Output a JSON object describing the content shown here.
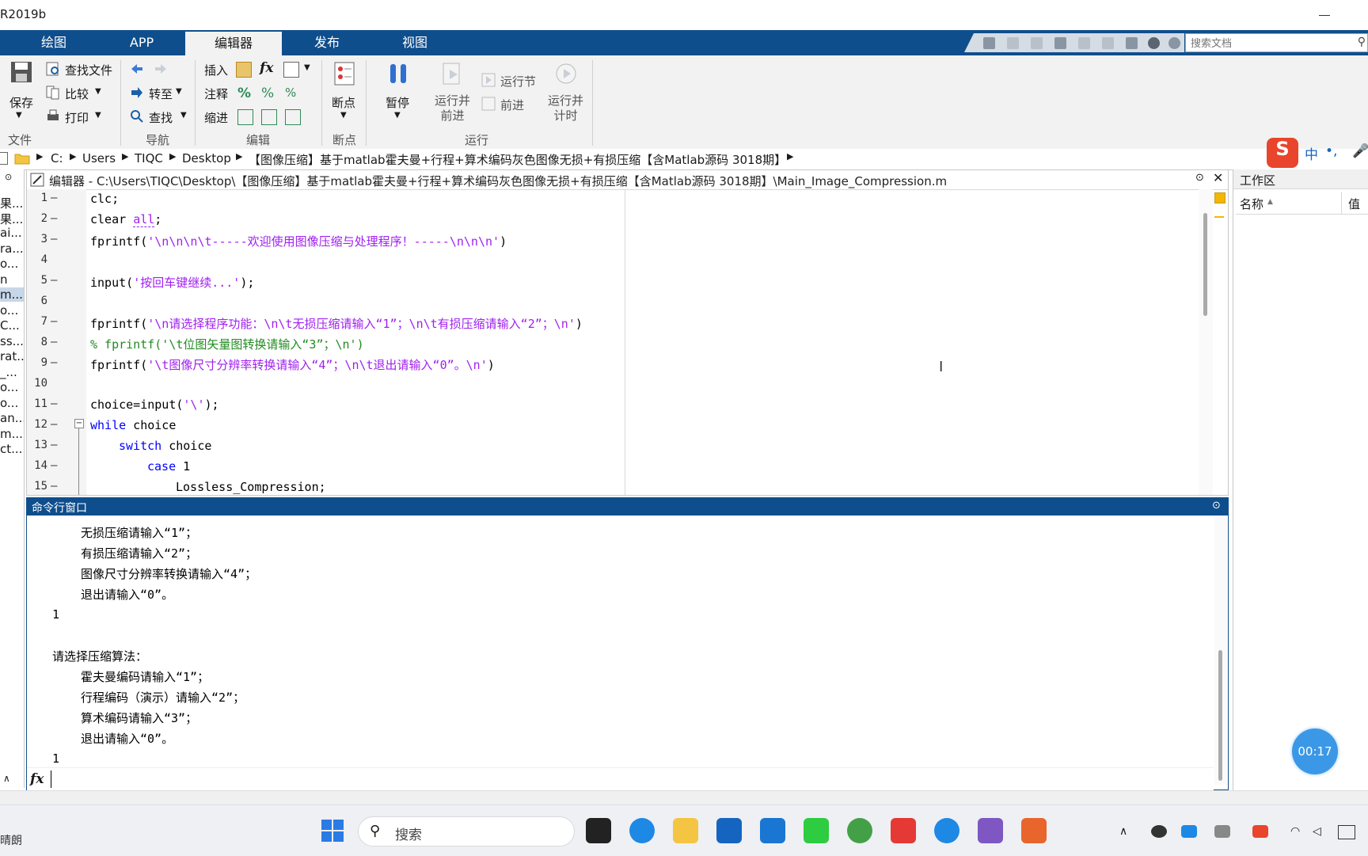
{
  "window": {
    "title": "R2019b"
  },
  "tabs": [
    {
      "label": "绘图",
      "active": false
    },
    {
      "label": "APP",
      "active": false
    },
    {
      "label": "编辑器",
      "active": true
    },
    {
      "label": "发布",
      "active": false
    },
    {
      "label": "视图",
      "active": false
    }
  ],
  "search_docs": {
    "placeholder": "搜索文档"
  },
  "ribbon": {
    "file": {
      "save": "保存",
      "find_files": "查找文件",
      "compare": "比较",
      "print": "打印",
      "group": "文件"
    },
    "nav": {
      "goto": "转至",
      "find": "查找",
      "group": "导航"
    },
    "edit": {
      "insert": "插入",
      "comment": "注释",
      "indent": "缩进",
      "group": "编辑"
    },
    "breakpoints": {
      "label": "断点",
      "group": "断点"
    },
    "run": {
      "pause": "暂停",
      "run_advance": "运行并\n前进",
      "run_section": "运行节",
      "advance": "前进",
      "run_time": "运行并\n计时",
      "group": "运行"
    }
  },
  "address": {
    "crumbs": [
      "C:",
      "Users",
      "TIQC",
      "Desktop",
      "【图像压缩】基于matlab霍夫曼+行程+算术编码灰色图像无损+有损压缩【含Matlab源码 3018期】"
    ]
  },
  "left_panel": {
    "files": [
      "果...",
      "果...",
      "ai...",
      "ra...",
      "o...",
      "n",
      "m...",
      "o...",
      "C...",
      "ss...",
      "rat...",
      "_...",
      "o...",
      "o...",
      "an...",
      "m...",
      "ct..."
    ]
  },
  "editor": {
    "title": "编辑器 - C:\\Users\\TIQC\\Desktop\\【图像压缩】基于matlab霍夫曼+行程+算术编码灰色图像无损+有损压缩【含Matlab源码 3018期】\\Main_Image_Compression.m",
    "line_numbers": [
      "1",
      "2",
      "3",
      "4",
      "5",
      "6",
      "7",
      "8",
      "9",
      "10",
      "11",
      "12",
      "13",
      "14",
      "15"
    ],
    "lines": {
      "l1": "clc;",
      "l2a": "clear ",
      "l2b": "all",
      "l2c": ";",
      "l3a": "fprintf(",
      "l3b": "'\\n\\n\\n\\t-----欢迎使用图像压缩与处理程序！-----\\n\\n\\n'",
      "l3c": ")",
      "l5a": "input(",
      "l5b": "'按回车键继续...'",
      "l5c": ");",
      "l7a": "fprintf(",
      "l7b": "'\\n请选择程序功能：\\n\\t无损压缩请输入“1”；\\n\\t有损压缩请输入“2”；\\n'",
      "l7c": ")",
      "l8": "% fprintf('\\t位图矢量图转换请输入“3”；\\n')",
      "l9a": "fprintf(",
      "l9b": "'\\t图像尺寸分辨率转换请输入“4”；\\n\\t退出请输入“0”。\\n'",
      "l9c": ")",
      "l11a": "choice=input(",
      "l11b": "'\\'",
      "l11c": ");",
      "l12a": "while",
      "l12b": " choice",
      "l13a": "switch",
      "l13b": " choice",
      "l14a": "case",
      "l14b": " 1",
      "l15": "Lossless_Compression;"
    }
  },
  "command_window": {
    "title": "命令行窗口",
    "lines": [
      "无损压缩请输入“1”；",
      "有损压缩请输入“2”；",
      "图像尺寸分辨率转换请输入“4”；",
      "退出请输入“0”。",
      "1",
      "请选择压缩算法：",
      "霍夫曼编码请输入“1”；",
      "行程编码（演示）请输入“2”；",
      "算术编码请输入“3”；",
      "退出请输入“0”。",
      "1"
    ],
    "prompt_value": ""
  },
  "workspace": {
    "title": "工作区",
    "col_name": "名称",
    "col_value": "值"
  },
  "ime": {
    "lang": "中",
    "punct": "•,"
  },
  "timer": "00:17",
  "taskbar": {
    "weather": "晴朗",
    "search": "搜索"
  },
  "colors": {
    "ribbon_blue": "#0f4e8c",
    "string": "#a020f0",
    "keyword": "#0000ff",
    "comment": "#228b22"
  }
}
